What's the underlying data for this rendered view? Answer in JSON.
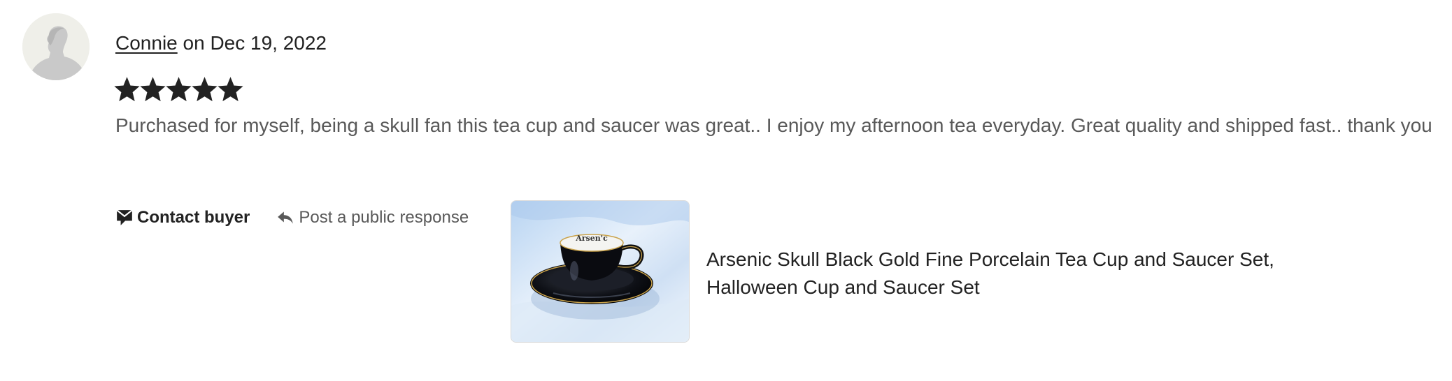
{
  "review": {
    "reviewer_name": "Connie",
    "date_text": "on Dec 19, 2022",
    "rating": 5,
    "rating_max": 5,
    "text": "Purchased for myself, being a skull fan this tea cup and saucer was great.. I enjoy my afternoon tea everyday. Great quality and shipped fast.. thank you"
  },
  "actions": {
    "contact_buyer_label": "Contact buyer",
    "public_response_label": "Post a public response"
  },
  "listing": {
    "title": "Arsenic Skull Black Gold Fine Porcelain Tea Cup and Saucer Set, Halloween Cup and Saucer Set",
    "cup_text": "Arsen'c"
  },
  "colors": {
    "star": "#222222",
    "avatar_bg": "#efefe9",
    "muted_text": "#595959"
  },
  "icons": {
    "avatar": "person-silhouette-icon",
    "star": "star-icon",
    "contact": "message-icon",
    "reply": "reply-arrow-icon"
  }
}
